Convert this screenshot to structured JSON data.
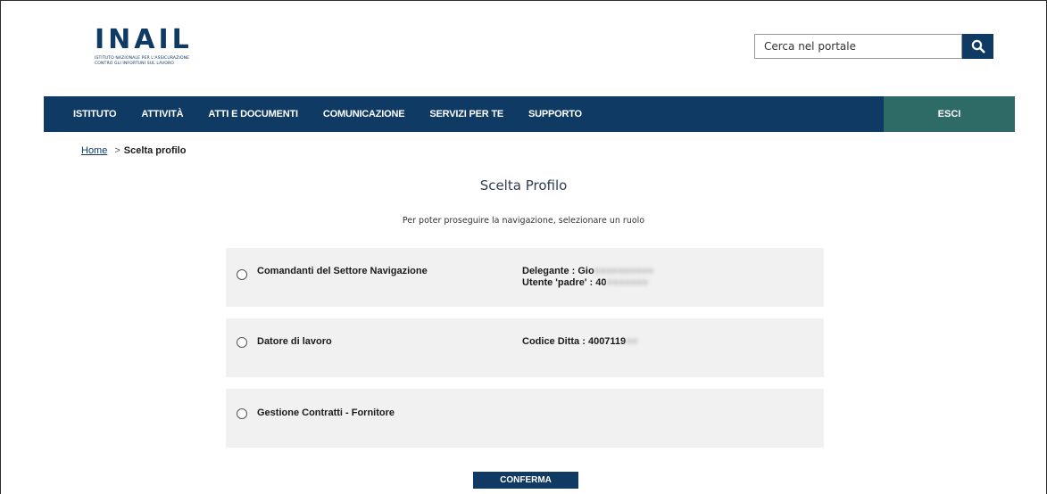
{
  "header": {
    "logo_text": "INAIL",
    "logo_subtitle_line1": "ISTITUTO NAZIONALE PER L'ASSICURAZIONE",
    "logo_subtitle_line2": "CONTRO GLI INFORTUNI SUL LAVORO",
    "search_placeholder": "Cerca nel portale",
    "search_icon": "search-icon",
    "brand_color": "#0e3a63"
  },
  "navbar": {
    "items": [
      {
        "label": "ISTITUTO"
      },
      {
        "label": "ATTIVITÀ"
      },
      {
        "label": "ATTI E DOCUMENTI"
      },
      {
        "label": "COMUNICAZIONE"
      },
      {
        "label": "SERVIZI PER TE"
      },
      {
        "label": "SUPPORTO"
      }
    ],
    "exit_label": "ESCI",
    "exit_color": "#2f6b66"
  },
  "breadcrumb": {
    "home": "Home",
    "separator": ">",
    "current": "Scelta profilo"
  },
  "main": {
    "title": "Scelta Profilo",
    "instructions": "Per poter proseguire la navigazione, selezionare un ruolo",
    "profiles": [
      {
        "role": "Comandanti del Settore Navigazione",
        "info_lines": [
          {
            "label": "Delegante : ",
            "value": "Gio"
          },
          {
            "label": "Utente 'padre' : ",
            "value": "40"
          }
        ]
      },
      {
        "role": "Datore di lavoro",
        "info_lines": [
          {
            "label": "Codice Ditta : ",
            "value": "4007119"
          }
        ]
      },
      {
        "role": "Gestione Contratti - Fornitore",
        "info_lines": []
      }
    ],
    "confirm_label": "CONFERMA"
  }
}
